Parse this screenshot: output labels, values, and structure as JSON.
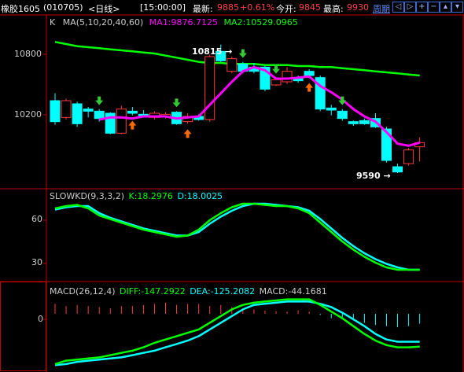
{
  "topbar": {
    "instrument": "橡胶1605",
    "code": "(010705)",
    "period": "<日线>",
    "time": "[15:00:00]",
    "latest_label": "最新:",
    "latest_value": "9885",
    "change": "+0.61%",
    "open_label": "今开:",
    "open_value": "9845",
    "high_label": "最高:",
    "high_value": "9930",
    "cycle_label": "周期",
    "controls": [
      "◁",
      "▷",
      "+",
      "−",
      "▴",
      "▾"
    ]
  },
  "main_panel": {
    "indicator_name": "K",
    "ma_params": "MA(5,10,20,40,60)",
    "ma1": "MA1:9876.7125",
    "ma2": "MA2:10529.0965",
    "y_ticks": [
      "10800",
      "10200"
    ],
    "high_marker": "10815",
    "low_marker": "9590"
  },
  "kd_panel": {
    "name": "SLOWKD(9,3,3,2)",
    "k": "K:18.2976",
    "d": "D:18.0025",
    "y_ticks": [
      "60",
      "30"
    ]
  },
  "macd_panel": {
    "name": "MACD(26,12,4)",
    "diff": "DIFF:-147.2922",
    "dea": "DEA:-125.2082",
    "macd": "MACD:-44.1681",
    "y_ticks": [
      "0"
    ]
  },
  "colors": {
    "up": "#ff3b3b",
    "down": "#00ffff",
    "ma_green": "#00ff00",
    "ma_magenta": "#ff00ff",
    "grid_red": "#c00000",
    "up_arrow": "#ff6a00",
    "down_arrow": "#33cc33"
  },
  "chart_data": {
    "type": "candlestick",
    "y_range": [
      9500,
      11000
    ],
    "candles": [
      {
        "o": 10280,
        "c": 10080,
        "h": 10350,
        "l": 10050
      },
      {
        "o": 10120,
        "c": 10280,
        "h": 10300,
        "l": 10100
      },
      {
        "o": 10250,
        "c": 10060,
        "h": 10270,
        "l": 10030
      },
      {
        "o": 10200,
        "c": 10180,
        "h": 10220,
        "l": 10120
      },
      {
        "o": 10180,
        "c": 10110,
        "h": 10200,
        "l": 10080
      },
      {
        "o": 10160,
        "c": 9970,
        "h": 10170,
        "l": 9960
      },
      {
        "o": 9970,
        "c": 10200,
        "h": 10230,
        "l": 9960
      },
      {
        "o": 10180,
        "c": 10160,
        "h": 10220,
        "l": 10140
      },
      {
        "o": 10150,
        "c": 10130,
        "h": 10190,
        "l": 10120
      },
      {
        "o": 10120,
        "c": 10160,
        "h": 10180,
        "l": 10100
      },
      {
        "o": 10130,
        "c": 10150,
        "h": 10170,
        "l": 10110
      },
      {
        "o": 10170,
        "c": 10060,
        "h": 10180,
        "l": 10050
      },
      {
        "o": 10080,
        "c": 10130,
        "h": 10160,
        "l": 10060
      },
      {
        "o": 10130,
        "c": 10100,
        "h": 10150,
        "l": 10090
      },
      {
        "o": 10100,
        "c": 10700,
        "h": 10720,
        "l": 10080
      },
      {
        "o": 10750,
        "c": 10660,
        "h": 10815,
        "l": 10650
      },
      {
        "o": 10560,
        "c": 10680,
        "h": 10700,
        "l": 10540
      },
      {
        "o": 10630,
        "c": 10560,
        "h": 10650,
        "l": 10540
      },
      {
        "o": 10600,
        "c": 10560,
        "h": 10640,
        "l": 10540
      },
      {
        "o": 10600,
        "c": 10390,
        "h": 10610,
        "l": 10370
      },
      {
        "o": 10430,
        "c": 10480,
        "h": 10500,
        "l": 10420
      },
      {
        "o": 10460,
        "c": 10560,
        "h": 10600,
        "l": 10440
      },
      {
        "o": 10500,
        "c": 10470,
        "h": 10520,
        "l": 10450
      },
      {
        "o": 10560,
        "c": 10520,
        "h": 10580,
        "l": 10500
      },
      {
        "o": 10500,
        "c": 10200,
        "h": 10520,
        "l": 10180
      },
      {
        "o": 10210,
        "c": 10190,
        "h": 10240,
        "l": 10140
      },
      {
        "o": 10180,
        "c": 10110,
        "h": 10200,
        "l": 10090
      },
      {
        "o": 10080,
        "c": 10060,
        "h": 10090,
        "l": 10040
      },
      {
        "o": 10090,
        "c": 10060,
        "h": 10110,
        "l": 10050
      },
      {
        "o": 10110,
        "c": 10030,
        "h": 10160,
        "l": 10020
      },
      {
        "o": 10010,
        "c": 9710,
        "h": 10030,
        "l": 9690
      },
      {
        "o": 9650,
        "c": 9600,
        "h": 9680,
        "l": 9590
      },
      {
        "o": 9680,
        "c": 9810,
        "h": 9830,
        "l": 9660
      },
      {
        "o": 9840,
        "c": 9880,
        "h": 9930,
        "l": 9700
      }
    ],
    "ma1": [
      null,
      null,
      null,
      null,
      10100,
      10120,
      10120,
      10110,
      10130,
      10130,
      10130,
      10110,
      10120,
      10130,
      10240,
      10350,
      10460,
      10560,
      10600,
      10570,
      10490,
      10490,
      10500,
      10510,
      10420,
      10360,
      10290,
      10200,
      10130,
      10080,
      9980,
      9870,
      9850,
      9880
    ],
    "ma2": [
      10840,
      10820,
      10800,
      10790,
      10780,
      10770,
      10760,
      10750,
      10740,
      10730,
      10710,
      10690,
      10670,
      10650,
      10640,
      10640,
      10630,
      10630,
      10630,
      10620,
      10620,
      10620,
      10610,
      10610,
      10600,
      10600,
      10590,
      10580,
      10570,
      10560,
      10550,
      10540,
      10530,
      10520
    ],
    "kd_range": [
      10,
      80
    ],
    "slow_k": [
      70,
      72,
      73,
      70,
      64,
      61,
      58,
      55,
      52,
      50,
      48,
      46,
      47,
      52,
      60,
      66,
      71,
      74,
      74,
      73,
      72,
      72,
      70,
      66,
      58,
      50,
      42,
      35,
      29,
      24,
      20,
      18,
      18,
      18
    ],
    "slow_d": [
      69,
      71,
      72,
      72,
      66,
      62,
      59,
      56,
      53,
      51,
      49,
      47,
      47,
      50,
      57,
      63,
      68,
      72,
      74,
      74,
      73,
      72,
      71,
      68,
      61,
      53,
      45,
      38,
      32,
      27,
      23,
      20,
      18,
      18
    ],
    "macd_range": [
      -250,
      120
    ],
    "diff": [
      -225,
      -210,
      -205,
      -200,
      -195,
      -185,
      -175,
      -165,
      -150,
      -130,
      -115,
      -100,
      -85,
      -70,
      -40,
      -10,
      20,
      40,
      50,
      55,
      60,
      65,
      65,
      65,
      40,
      10,
      -20,
      -55,
      -90,
      -120,
      -140,
      -150,
      -150,
      -147
    ],
    "dea": [
      -230,
      -225,
      -215,
      -210,
      -205,
      -200,
      -195,
      -185,
      -175,
      -165,
      -150,
      -135,
      -120,
      -100,
      -70,
      -40,
      -10,
      20,
      40,
      45,
      50,
      55,
      55,
      55,
      45,
      30,
      5,
      -25,
      -55,
      -90,
      -115,
      -125,
      -125,
      -125
    ],
    "macd_hist": [
      45,
      35,
      40,
      35,
      30,
      25,
      35,
      35,
      40,
      45,
      50,
      40,
      45,
      45,
      35,
      40,
      30,
      25,
      20,
      15,
      12,
      10,
      15,
      10,
      -5,
      -20,
      -25,
      -30,
      -40,
      -50,
      -55,
      -60,
      -55,
      -44
    ],
    "signals_down": [
      4,
      11,
      17,
      20,
      26
    ],
    "signals_up": [
      7,
      12,
      23
    ]
  }
}
